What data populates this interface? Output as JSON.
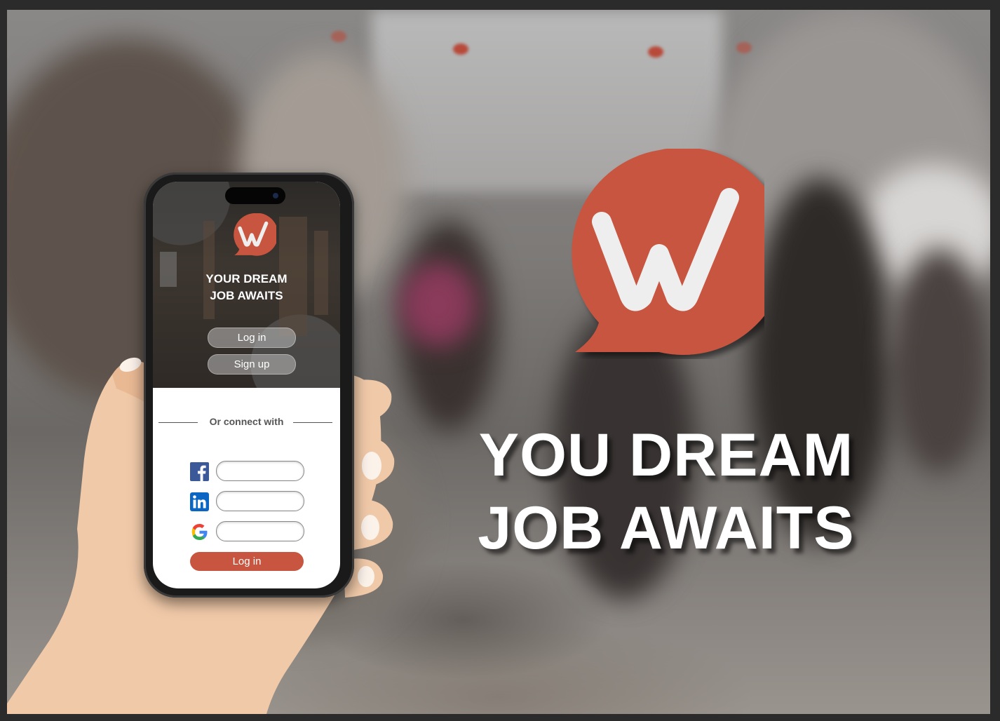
{
  "brand": {
    "logo_letter": "W",
    "accent_color": "#c8553f",
    "headline_line1": "YOU DREAM",
    "headline_line2": "JOB AWAITS"
  },
  "phone_app": {
    "title_line1": "YOUR DREAM",
    "title_line2": "JOB AWAITS",
    "login_button": "Log in",
    "signup_button": "Sign up",
    "connect_label": "Or connect with",
    "social_providers": [
      {
        "name": "facebook",
        "icon": "facebook-icon"
      },
      {
        "name": "linkedin",
        "icon": "linkedin-icon"
      },
      {
        "name": "google",
        "icon": "google-icon"
      }
    ],
    "submit_button": "Log in"
  }
}
